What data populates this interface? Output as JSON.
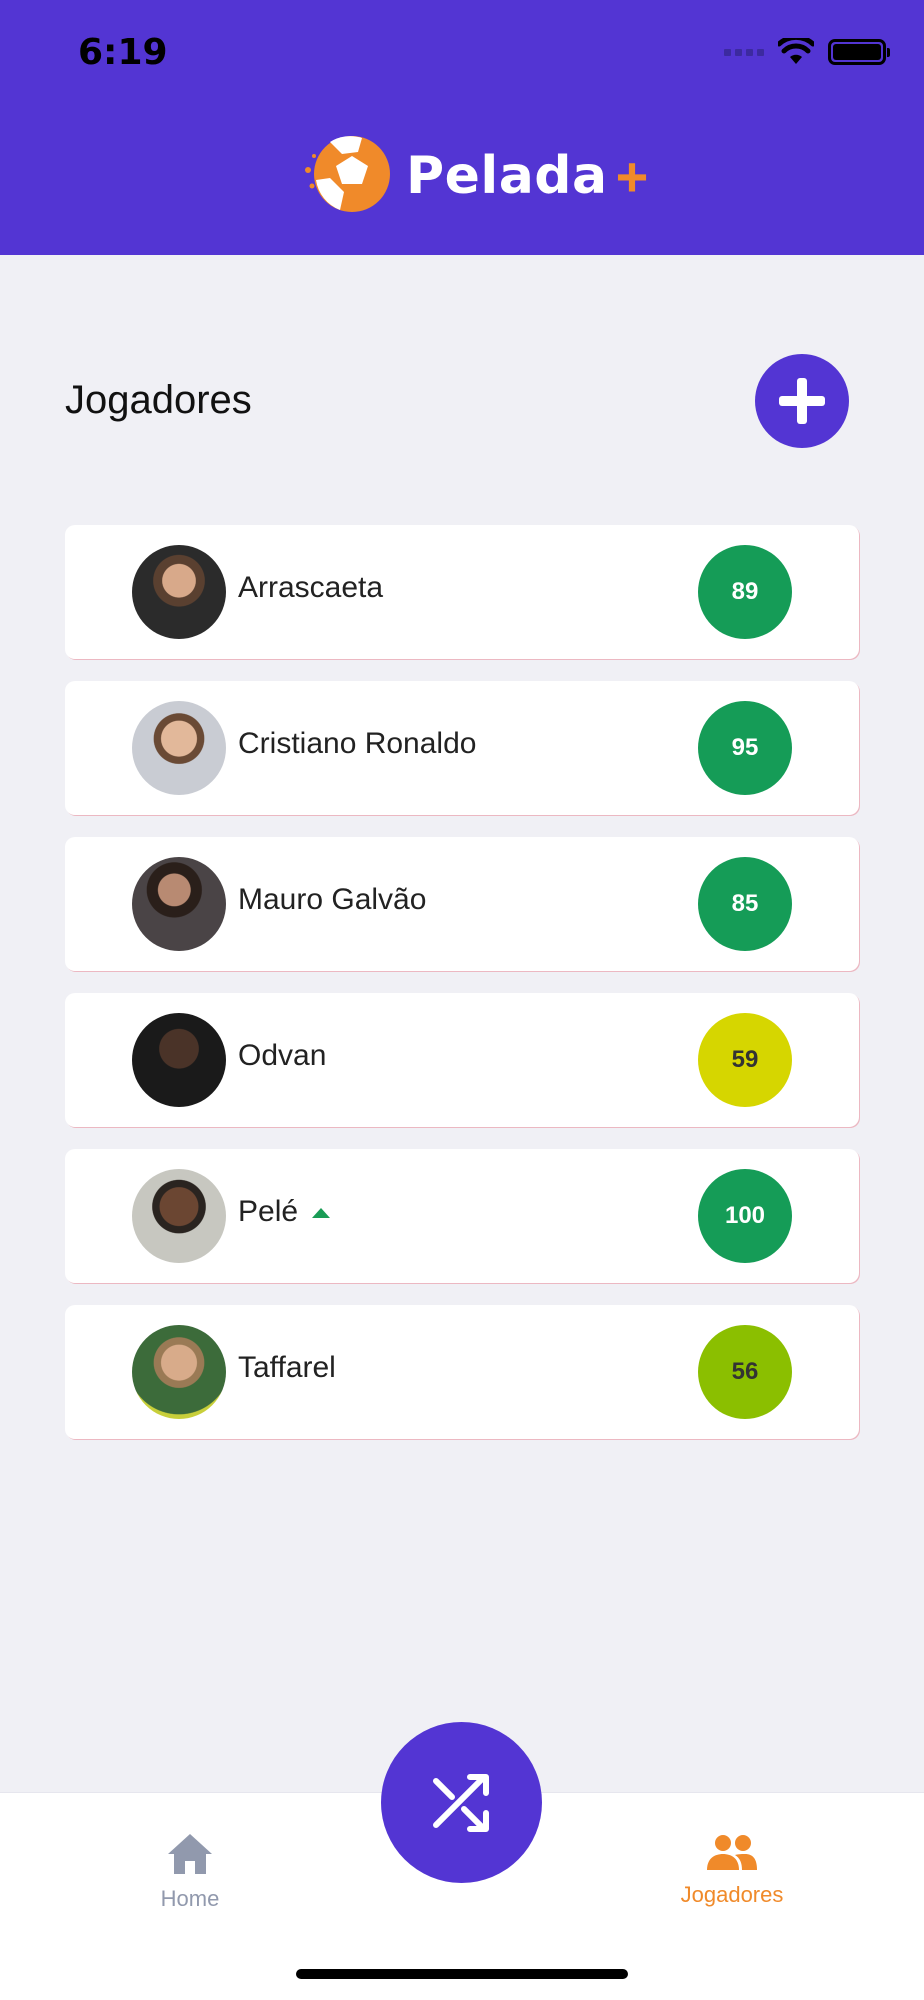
{
  "status_bar": {
    "time": "6:19"
  },
  "header": {
    "app_name": "Pelada",
    "app_plus": "+"
  },
  "page": {
    "title": "Jogadores"
  },
  "players": [
    {
      "name": "Arrascaeta",
      "score": "89",
      "score_color": "#159c57",
      "trend": ""
    },
    {
      "name": "Cristiano Ronaldo",
      "score": "95",
      "score_color": "#159c57",
      "trend": ""
    },
    {
      "name": "Mauro Galvão",
      "score": "85",
      "score_color": "#159c57",
      "trend": ""
    },
    {
      "name": "Odvan",
      "score": "59",
      "score_color": "#d6d600",
      "trend": ""
    },
    {
      "name": "Pelé",
      "score": "100",
      "score_color": "#159c57",
      "trend": "up"
    },
    {
      "name": "Taffarel",
      "score": "56",
      "score_color": "#8bbf00",
      "trend": ""
    }
  ],
  "bottom_nav": {
    "home_label": "Home",
    "players_label": "Jogadores"
  },
  "colors": {
    "primary": "#5335d3",
    "accent": "#f08a2a",
    "inactive": "#9199ad"
  }
}
